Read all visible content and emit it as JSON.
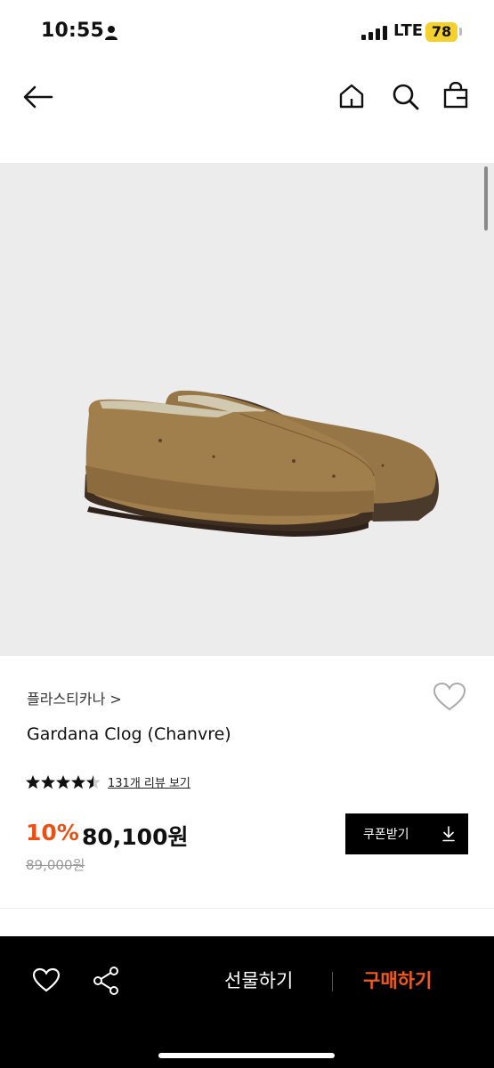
{
  "status_bar": {
    "time": "10:55",
    "network": "LTE",
    "battery": "78",
    "battery_color": "#f5d130",
    "icons": [
      "person-icon",
      "signal-icon"
    ]
  },
  "nav": {
    "icons": [
      "back-arrow-icon",
      "home-icon",
      "search-icon",
      "shopping-bag-icon"
    ]
  },
  "product": {
    "brand": "플라스티카나 >",
    "name": "Gardana Clog (Chanvre)",
    "rating_stars": 4.5,
    "review_link": "131개 리뷰 보기",
    "discount": "10%",
    "price": "80,100원",
    "original_price": "89,000원",
    "coupon_label": "쿠폰받기",
    "accent_color": "#ea4f14",
    "image_icon": "clog-shoe-image"
  },
  "bottom_bar": {
    "gift_label": "선물하기",
    "buy_label": "구매하기",
    "icons": [
      "heart-icon",
      "share-icon"
    ]
  }
}
